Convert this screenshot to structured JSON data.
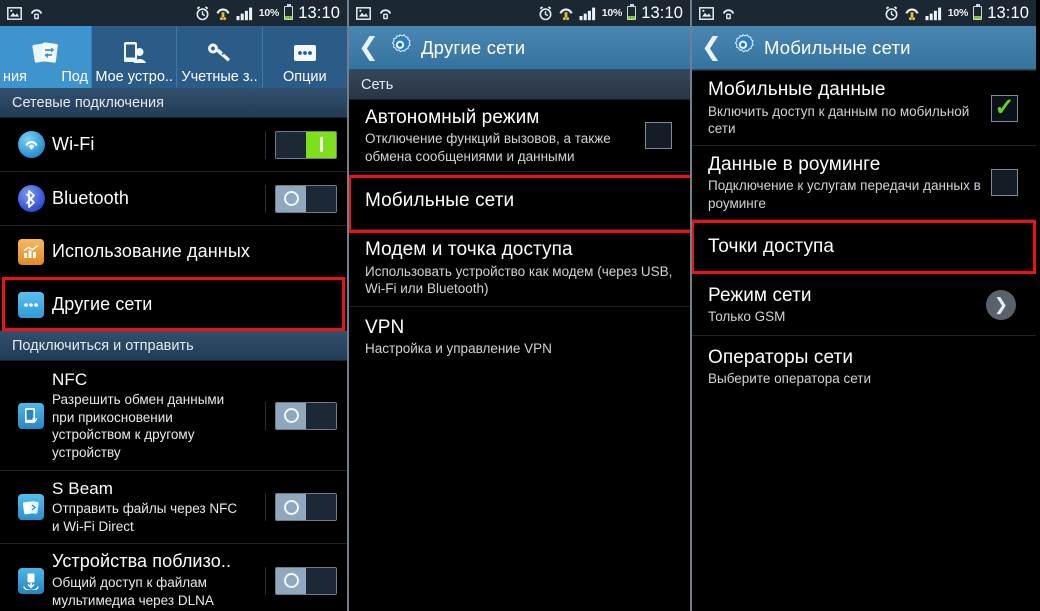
{
  "statusbar": {
    "time": "13:10",
    "battery_percent": "10%",
    "icons": [
      "image-icon",
      "wifi-direct-icon",
      "alarm-icon",
      "wifi-signal-icon",
      "cellular-signal-icon",
      "battery-icon"
    ]
  },
  "panel1": {
    "tabs": [
      {
        "label_left": "ния",
        "label_right": "Под",
        "label": "Подключения",
        "icon": "connections-icon",
        "active": true
      },
      {
        "label": "Мое устро..",
        "icon": "my-device-icon",
        "active": false
      },
      {
        "label": "Учетные з..",
        "icon": "accounts-key-icon",
        "active": false
      },
      {
        "label": "Опции",
        "icon": "more-options-icon",
        "active": false
      }
    ],
    "sections": [
      {
        "header": "Сетевые подключения",
        "items": [
          {
            "title": "Wi-Fi",
            "sub": "",
            "icon": "wifi-icon",
            "control": "toggle",
            "state": "on"
          },
          {
            "title": "Bluetooth",
            "sub": "",
            "icon": "bluetooth-icon",
            "control": "toggle",
            "state": "off"
          },
          {
            "title": "Использование данных",
            "sub": "",
            "icon": "data-usage-icon",
            "control": "none"
          },
          {
            "title": "Другие сети",
            "sub": "",
            "icon": "other-networks-icon",
            "control": "none",
            "highlighted": true
          }
        ]
      },
      {
        "header": "Подключиться и отправить",
        "items": [
          {
            "title": "NFC",
            "sub": "Разрешить обмен данными при прикосновении устройством к другому устройству",
            "icon": "nfc-icon",
            "control": "toggle",
            "state": "off"
          },
          {
            "title": "S Beam",
            "sub": "Отправить файлы через NFC и Wi-Fi Direct",
            "icon": "s-beam-icon",
            "control": "toggle",
            "state": "off"
          },
          {
            "title": "Устройства поблизо..",
            "sub": "Общий доступ к файлам мультимедиа через DLNA",
            "icon": "nearby-devices-icon",
            "control": "toggle",
            "state": "off"
          }
        ]
      }
    ]
  },
  "panel2": {
    "title": "Другие сети",
    "back_icon": "back-chevron-icon",
    "settings_icon": "settings-gear-icon",
    "section_header": "Сеть",
    "items": [
      {
        "title": "Автономный режим",
        "sub": "Отключение функций вызовов, а также обмена сообщениями и данными",
        "control": "checkbox",
        "state": "unchecked"
      },
      {
        "title": "Мобильные сети",
        "sub": "",
        "control": "none",
        "highlighted": true
      },
      {
        "title": "Модем и точка доступа",
        "sub": "Использовать устройство как модем (через USB, Wi-Fi или Bluetooth)",
        "control": "none"
      },
      {
        "title": "VPN",
        "sub": "Настройка и управление VPN",
        "control": "none"
      }
    ]
  },
  "panel3": {
    "title": "Мобильные сети",
    "back_icon": "back-chevron-icon",
    "settings_icon": "settings-gear-icon",
    "items": [
      {
        "title": "Мобильные данные",
        "sub": "Включить доступ к данным по мобильной сети",
        "control": "checkbox",
        "state": "checked"
      },
      {
        "title": "Данные в роуминге",
        "sub": "Подключение к услугам передачи данных в роуминге",
        "control": "checkbox",
        "state": "unchecked"
      },
      {
        "title": "Точки доступа",
        "sub": "",
        "control": "none",
        "highlighted": true
      },
      {
        "title": "Режим сети",
        "sub": "Только GSM",
        "control": "chevron"
      },
      {
        "title": "Операторы сети",
        "sub": "Выберите оператора сети",
        "control": "none"
      }
    ]
  },
  "colors": {
    "accent_blue": "#3d7ba8",
    "highlight_red": "#ee1111",
    "toggle_on_green": "#7ee01c",
    "check_green": "#5fd326"
  }
}
